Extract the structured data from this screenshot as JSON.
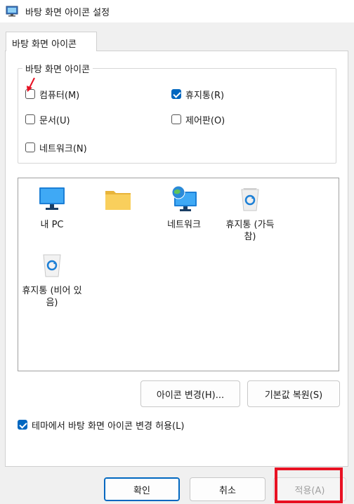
{
  "window": {
    "title": "바탕 화면 아이콘 설정",
    "icon": "display-settings-icon"
  },
  "tab": {
    "label": "바탕 화면 아이콘"
  },
  "group": {
    "label": "바탕 화면 아이콘",
    "checkboxes": [
      {
        "label": "컴퓨터(M)",
        "checked": false
      },
      {
        "label": "휴지통(R)",
        "checked": true
      },
      {
        "label": "문서(U)",
        "checked": false
      },
      {
        "label": "제어판(O)",
        "checked": false
      },
      {
        "label": "네트워크(N)",
        "checked": false
      }
    ]
  },
  "icons": [
    {
      "label": "내 PC",
      "icon": "monitor-icon"
    },
    {
      "label": "",
      "icon": "folder-icon"
    },
    {
      "label": "네트워크",
      "icon": "network-globe-icon"
    },
    {
      "label": "휴지통 (가득 참)",
      "icon": "recycle-bin-full-icon"
    },
    {
      "label": "휴지통 (비어 있음)",
      "icon": "recycle-bin-empty-icon"
    }
  ],
  "buttons": {
    "change_icon": "아이콘 변경(H)...",
    "restore_default": "기본값 복원(S)",
    "ok": "확인",
    "cancel": "취소",
    "apply": "적용(A)"
  },
  "allow_themes": {
    "label": "테마에서 바탕 화면 아이콘 변경 허용(L)",
    "checked": true
  },
  "colors": {
    "accent": "#0067c0",
    "highlight": "#e81123"
  }
}
